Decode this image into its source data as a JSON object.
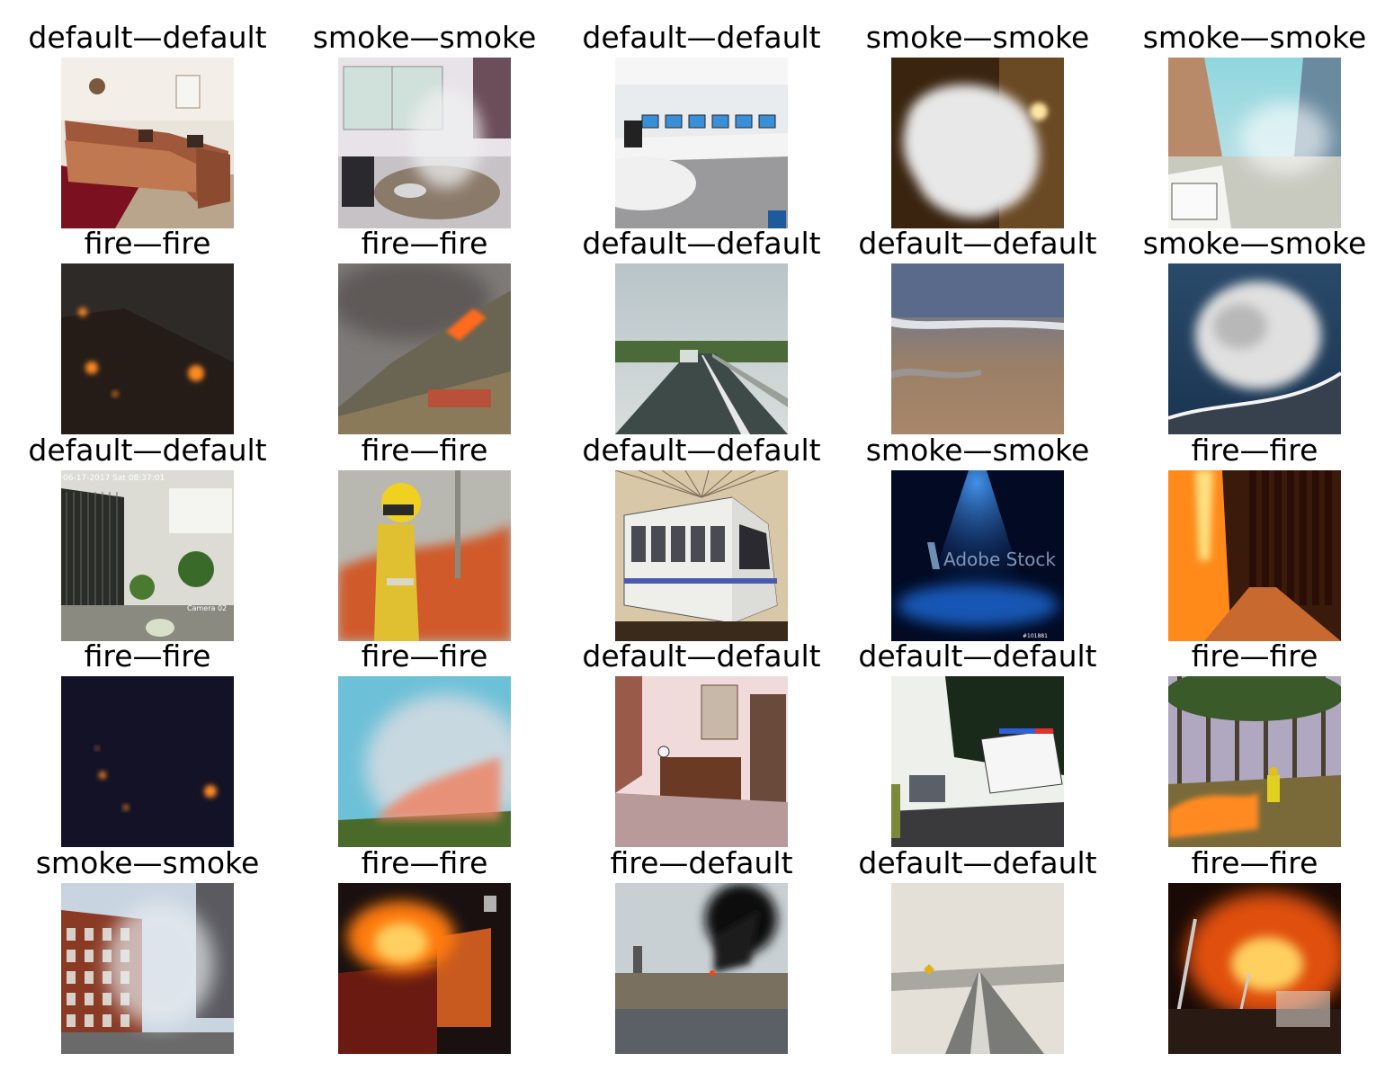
{
  "grid": {
    "rows": 5,
    "cols": 5,
    "items": [
      {
        "title": "default—default",
        "scene": "living-room-sofa"
      },
      {
        "title": "smoke—smoke",
        "scene": "kitchen-smoke"
      },
      {
        "title": "default—default",
        "scene": "office-computers"
      },
      {
        "title": "smoke—smoke",
        "scene": "white-smoke-dark-room"
      },
      {
        "title": "smoke—smoke",
        "scene": "street-smoke"
      },
      {
        "title": "fire—fire",
        "scene": "night-hill-fire"
      },
      {
        "title": "fire—fire",
        "scene": "hillside-wildfire"
      },
      {
        "title": "default—default",
        "scene": "highway"
      },
      {
        "title": "default—default",
        "scene": "beach"
      },
      {
        "title": "smoke—smoke",
        "scene": "sea-smoke-cloud"
      },
      {
        "title": "default—default",
        "scene": "cctv-room"
      },
      {
        "title": "fire—fire",
        "scene": "firefighter"
      },
      {
        "title": "default—default",
        "scene": "train"
      },
      {
        "title": "smoke—smoke",
        "scene": "blue-stage-light"
      },
      {
        "title": "fire—fire",
        "scene": "forest-fire-road"
      },
      {
        "title": "fire—fire",
        "scene": "dark-night-fire"
      },
      {
        "title": "fire—fire",
        "scene": "smoke-plume-fire"
      },
      {
        "title": "default—default",
        "scene": "bedroom-dresser"
      },
      {
        "title": "default—default",
        "scene": "police-car-road"
      },
      {
        "title": "fire—fire",
        "scene": "forest-firefighter"
      },
      {
        "title": "smoke—smoke",
        "scene": "building-smoke"
      },
      {
        "title": "fire—fire",
        "scene": "burning-building-night"
      },
      {
        "title": "fire—default",
        "scene": "factory-black-smoke"
      },
      {
        "title": "default—default",
        "scene": "snowy-road"
      },
      {
        "title": "fire—fire",
        "scene": "house-fire-ladder"
      }
    ],
    "thumbnail_text": {
      "cctv_timestamp": "06-17-2017 Sat 08:37:01",
      "cctv_camera": "Camera 02",
      "stock_watermark": "Adobe Stock",
      "stock_id": "#101881"
    }
  }
}
